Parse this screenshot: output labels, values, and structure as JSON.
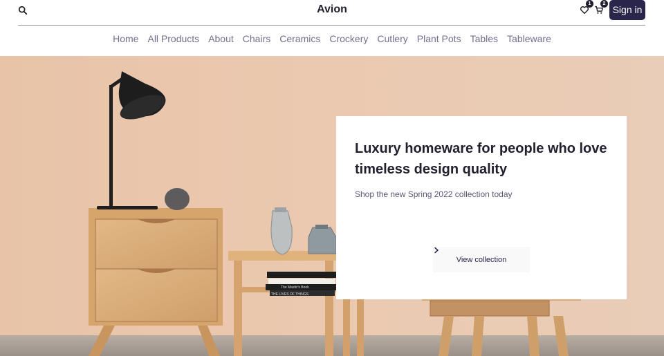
{
  "header": {
    "brand": "Avion",
    "wishlist_count": "1",
    "cart_count": "2",
    "signin_label": "Sign in",
    "icons": [
      "search-icon",
      "heart-icon",
      "cart-icon"
    ]
  },
  "nav": {
    "items": [
      "Home",
      "All Products",
      "About",
      "Chairs",
      "Ceramics",
      "Crockery",
      "Cutlery",
      "Plant Pots",
      "Tables",
      "Tableware"
    ]
  },
  "hero": {
    "headline": "Luxury homeware for people who love timeless design quality",
    "subtitle": "Shop the new Spring 2022 collection today",
    "cta_label": "View collection",
    "cta_icon": "chevron-right-icon"
  },
  "book_spines": [
    "THE LIVES OF THINGS",
    "The Mastic's Book"
  ],
  "colors": {
    "primary": "#2a254b",
    "nav_text": "#726e8d",
    "hero_wall": "#e8c6ae",
    "wood": "#d9ad78"
  }
}
